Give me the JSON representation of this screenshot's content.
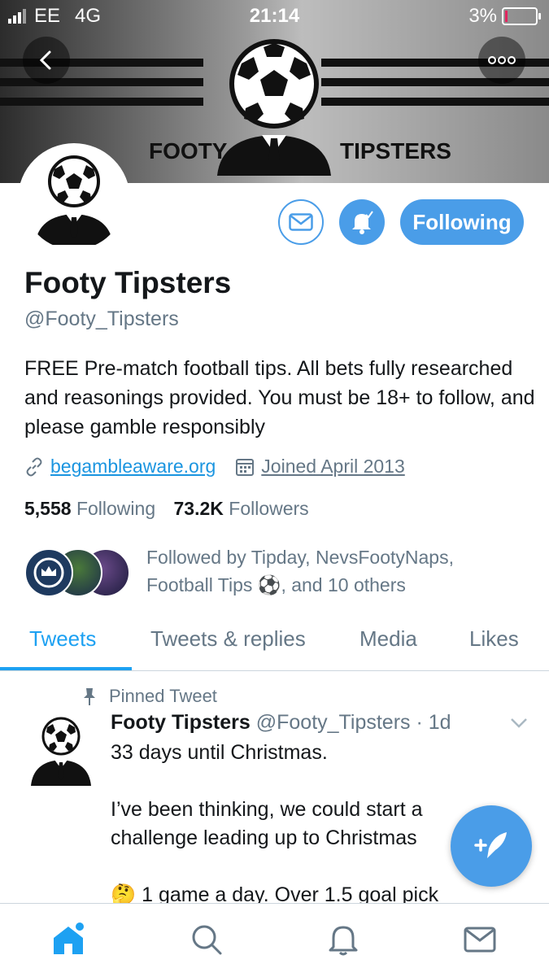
{
  "status_bar": {
    "carrier": "EE",
    "network": "4G",
    "time": "21:14",
    "battery": "3%"
  },
  "header": {
    "banner_left_text": "FOOTY",
    "banner_right_text": "TIPSTERS"
  },
  "profile": {
    "name": "Footy Tipsters",
    "handle": "@Footy_Tipsters",
    "bio": "FREE Pre-match football tips. All bets fully researched and reasonings provided. You must be 18+ to follow, and please gamble responsibly",
    "website": "begambleaware.org",
    "joined": "Joined April 2013",
    "following_count": "5,558",
    "following_label": "Following",
    "followers_count": "73.2K",
    "followers_label": "Followers",
    "follow_button": "Following",
    "followed_by_line1": "Followed by Tipday, NevsFootyNaps,",
    "followed_by_line2_a": "Football Tips",
    "followed_by_line2_b": ", and 10 others"
  },
  "tabs": [
    "Tweets",
    "Tweets & replies",
    "Media",
    "Likes"
  ],
  "tweet": {
    "pinned_label": "Pinned Tweet",
    "author": "Footy Tipsters",
    "handle": "@Footy_Tipsters",
    "time": "· 1d",
    "line1": "33 days until Christmas.",
    "line2": "I’ve been thinking, we could start a challenge leading up to Christmas",
    "line3": "1 game a day. Over 1.5 goal pick"
  },
  "icons": {
    "back": "back-arrow-icon",
    "more": "more-icon",
    "message": "envelope-icon",
    "notify": "bell-icon",
    "link": "link-icon",
    "calendar": "calendar-icon",
    "pin": "pin-icon",
    "chevron": "chevron-down-icon",
    "compose": "compose-icon",
    "home": "home-icon",
    "search": "search-icon",
    "notifications": "bell-icon",
    "messages": "envelope-icon"
  },
  "colors": {
    "accent": "#1da1f2",
    "button": "#4a9de8",
    "muted": "#657786",
    "text": "#14171a"
  }
}
